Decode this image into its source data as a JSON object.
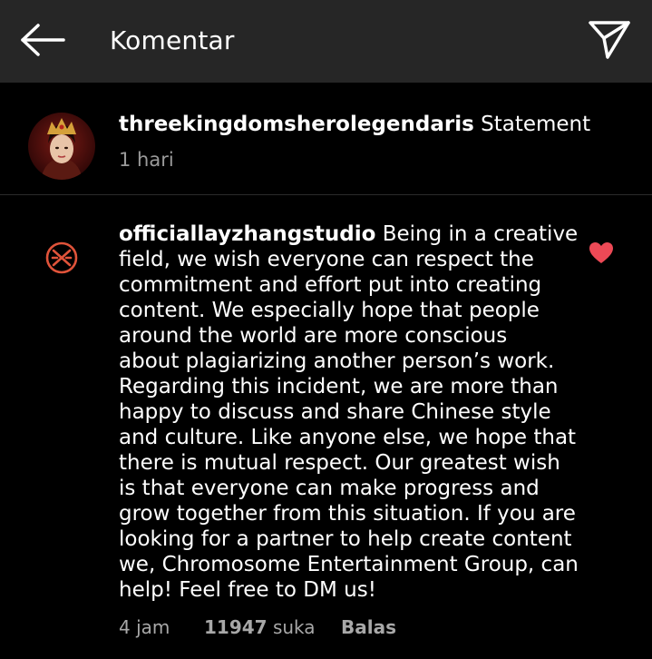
{
  "header": {
    "title": "Komentar",
    "back_icon": "arrow-left-icon",
    "send_icon": "paper-plane-icon"
  },
  "post": {
    "username": "threekingdomsherolegendaris",
    "caption": "Statement",
    "time": "1 hari",
    "avatar": "avatar-image"
  },
  "comment": {
    "username": "officiallayzhangstudio",
    "lines": [
      "Being in a creative",
      "field, we wish everyone can respect the",
      "commitment and effort put into creating",
      "content. We especially hope that people",
      "around the world are more conscious",
      "about plagiarizing another person’s work.",
      "Regarding this incident, we are more than",
      "happy to discuss and share Chinese style",
      "and culture. Like anyone else, we hope that",
      "there is mutual respect. Our greatest wish",
      "is that everyone can make progress and",
      "grow together from this situation. If you are",
      "looking for a partner to help create content",
      "we, Chromosome Entertainment Group, can",
      "help! Feel free to DM us!"
    ],
    "time": "4 jam",
    "likes_count": "11947",
    "likes_label": "suka",
    "reply_label": "Balas",
    "liked": true,
    "heart_color": "#ed4956",
    "logo_color": "#e0533a",
    "logo_icon": "studio-logo-icon",
    "heart_icon": "heart-filled-icon"
  },
  "colors": {
    "background": "#000000",
    "header_bg": "#262626",
    "secondary_text": "#a8a8a8"
  }
}
